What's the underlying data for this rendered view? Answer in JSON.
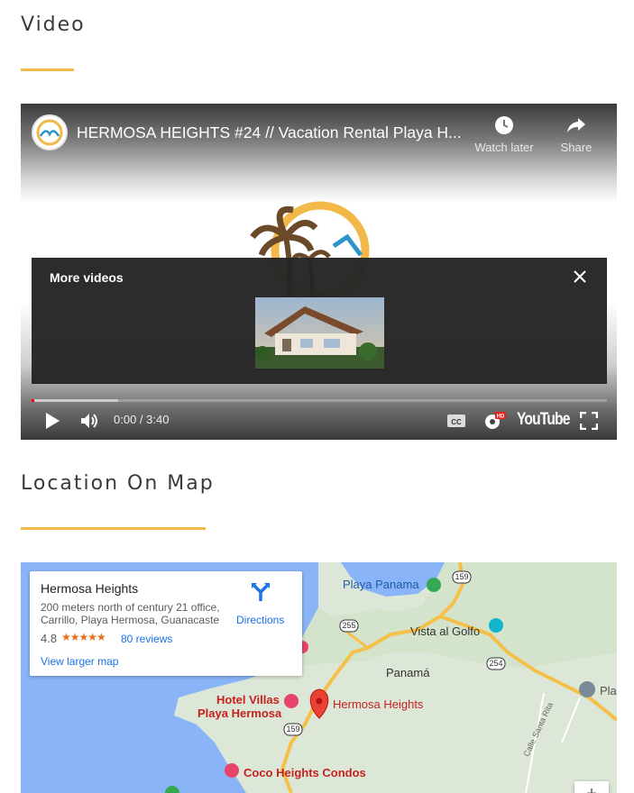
{
  "video_section": {
    "title": "Video"
  },
  "video": {
    "title": "HERMOSA HEIGHTS #24 // Vacation Rental Playa H...",
    "watch_later": "Watch later",
    "share": "Share",
    "more_videos": "More videos",
    "time": "0:00 / 3:40",
    "progress_played": 0.005,
    "progress_buffered": 0.15,
    "youtube_label": "YouTube",
    "icons": [
      "channel-avatar-icon",
      "clock-icon",
      "share-icon",
      "close-icon",
      "play-icon",
      "volume-icon",
      "captions-icon",
      "settings-hd-icon",
      "fullscreen-icon"
    ]
  },
  "map_section": {
    "title": "Location On Map"
  },
  "map": {
    "info": {
      "name": "Hermosa Heights",
      "address": "200 meters north of century 21 office, Carrillo, Playa Hermosa, Guanacaste",
      "rating": "4.8",
      "stars": "★★★★★",
      "reviews": "80 reviews",
      "view_larger": "View larger map",
      "directions": "Directions"
    },
    "places": {
      "playa_panama": "Playa Panama",
      "vista_al_golfo": "Vista al Golfo",
      "panama": "Panamá",
      "hermosa_heights": "Hermosa Heights",
      "hotel_villas_1": "Hotel Villas",
      "hotel_villas_2": "Playa Hermosa",
      "coco_heights": "Coco Heights Condos",
      "pla": "Pla",
      "calle_santa_rita": "Calle Santa Rita"
    },
    "roads": {
      "r159a": "159",
      "r255": "255",
      "r254": "254",
      "r159b": "159"
    },
    "zoom_in": "+",
    "colors": {
      "water": "#8ab4f8",
      "land": "#dde7d7",
      "road": "#f5c04a",
      "poi_pink": "#e8446a",
      "poi_green": "#34a853",
      "poi_teal": "#12b5cb",
      "pin_red": "#ea4335"
    }
  }
}
